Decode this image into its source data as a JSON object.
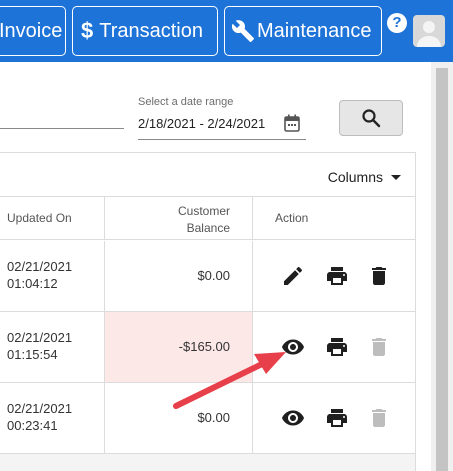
{
  "nav": {
    "invoice_label": "Invoice",
    "transaction_icon": "$",
    "transaction_label": "Transaction",
    "maintenance_label": "Maintenance",
    "help_icon": "?"
  },
  "filters": {
    "date_label": "Select a date range",
    "date_value": "2/18/2021 - 2/24/2021"
  },
  "table": {
    "columns_button": "Columns",
    "headers": {
      "updated_on": "Updated On",
      "customer_balance_line1": "Customer",
      "customer_balance_line2": "Balance",
      "action": "Action"
    },
    "rows": [
      {
        "date": "02/21/2021",
        "time": "01:04:12",
        "balance": "$0.00",
        "actions": [
          "edit-icon",
          "print-icon",
          "delete-icon"
        ]
      },
      {
        "date": "02/21/2021",
        "time": "01:15:54",
        "balance": "-$165.00",
        "actions": [
          "view-icon",
          "print-icon",
          "delete-icon-disabled"
        ]
      },
      {
        "date": "02/21/2021",
        "time": "00:23:41",
        "balance": "$0.00",
        "actions": [
          "view-icon",
          "print-icon",
          "delete-icon-disabled"
        ]
      }
    ]
  },
  "colors": {
    "topbar": "#1e73d8",
    "negative_row": "#fde8e8",
    "arrow": "#e8404a",
    "disabled_icon": "#bdbdbd"
  }
}
